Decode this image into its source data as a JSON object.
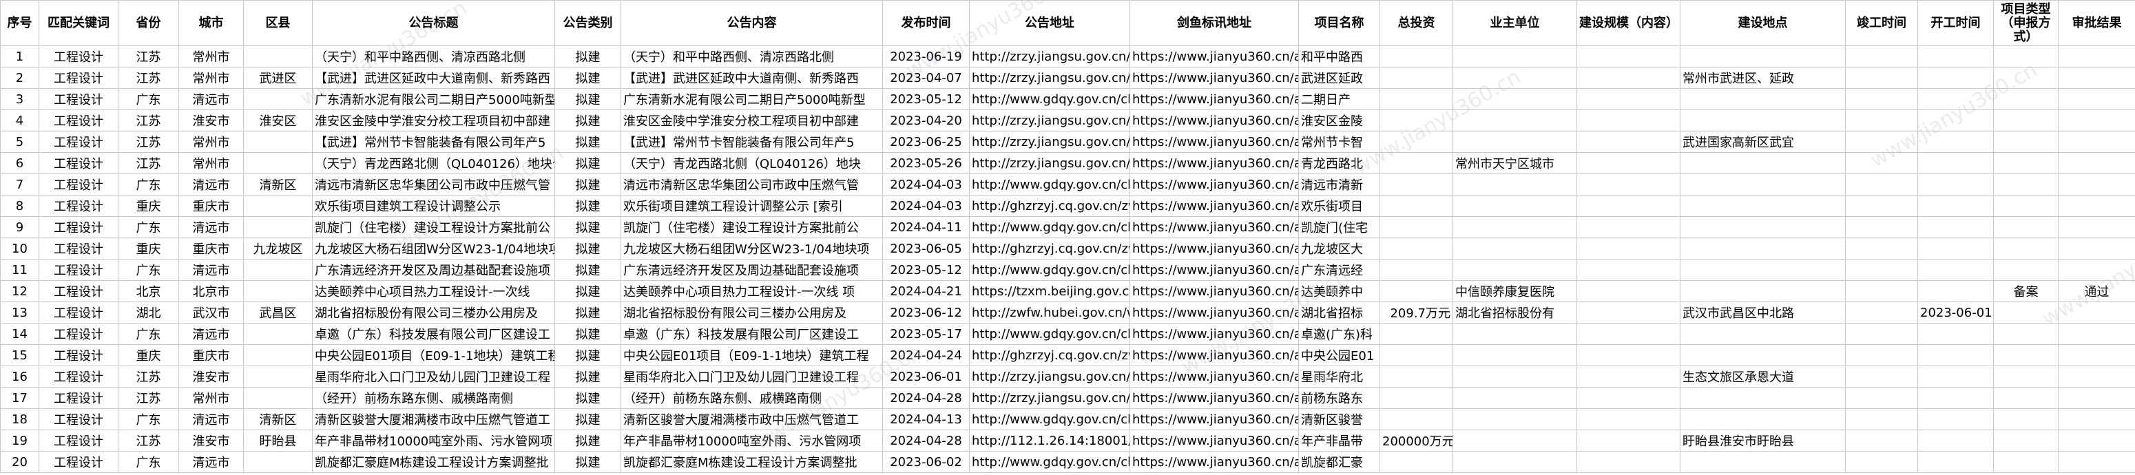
{
  "watermark": "www.jianyu360.cn",
  "columns": [
    "序号",
    "匹配关键词",
    "省份",
    "城市",
    "区县",
    "公告标题",
    "公告类别",
    "公告内容",
    "发布时间",
    "公告地址",
    "剑鱼标讯地址",
    "项目名称",
    "总投资",
    "业主单位",
    "建设规模（内容）",
    "建设地点",
    "竣工时间",
    "开工时间",
    "项目类型（申报方式）",
    "审批结果"
  ],
  "rows": [
    [
      "1",
      "工程设计",
      "江苏",
      "常州市",
      "",
      "（天宁）和平中路西侧、清凉西路北侧",
      "拟建",
      "（天宁）和平中路西侧、清凉西路北侧",
      "2023-06-19",
      "http://zrzy.jiangsu.gov.cn/gt",
      "https://www.jianyu360.cn/ar",
      "和平中路西",
      "",
      "",
      "",
      "",
      "",
      "",
      "",
      ""
    ],
    [
      "2",
      "工程设计",
      "江苏",
      "常州市",
      "武进区",
      "【武进】武进区延政中大道南侧、新秀路西",
      "拟建",
      "【武进】武进区延政中大道南侧、新秀路西",
      "2023-04-07",
      "http://zrzy.jiangsu.gov.cn/gt",
      "https://www.jianyu360.cn/ar",
      "武进区延政",
      "",
      "",
      "",
      "常州市武进区、延政",
      "",
      "",
      "",
      ""
    ],
    [
      "3",
      "工程设计",
      "广东",
      "清远市",
      "",
      "广东清新水泥有限公司二期日产5000吨新型",
      "拟建",
      "广东清新水泥有限公司二期日产5000吨新型",
      "2023-05-12",
      "http://www.gdqy.gov.cn/ch",
      "https://www.jianyu360.cn/ar",
      "二期日产",
      "",
      "",
      "",
      "",
      "",
      "",
      "",
      ""
    ],
    [
      "4",
      "工程设计",
      "江苏",
      "淮安市",
      "淮安区",
      "淮安区金陵中学淮安分校工程项目初中部建",
      "拟建",
      "淮安区金陵中学淮安分校工程项目初中部建",
      "2023-04-20",
      "http://zrzy.jiangsu.gov.cn/gt",
      "https://www.jianyu360.cn/ar",
      "淮安区金陵",
      "",
      "",
      "",
      "",
      "",
      "",
      "",
      ""
    ],
    [
      "5",
      "工程设计",
      "江苏",
      "常州市",
      "",
      "【武进】常州节卡智能装备有限公司年产5",
      "拟建",
      "【武进】常州节卡智能装备有限公司年产5",
      "2023-06-25",
      "http://zrzy.jiangsu.gov.cn/gt",
      "https://www.jianyu360.cn/ar",
      "常州节卡智",
      "",
      "",
      "",
      "武进国家高新区武宜",
      "",
      "",
      "",
      ""
    ],
    [
      "6",
      "工程设计",
      "江苏",
      "常州市",
      "",
      "（天宁）青龙西路北侧（QL040126）地块公",
      "拟建",
      "（天宁）青龙西路北侧（QL040126）地块",
      "2023-05-26",
      "http://zrzy.jiangsu.gov.cn/gt",
      "https://www.jianyu360.cn/ar",
      "青龙西路北",
      "",
      "常州市天宁区城市",
      "",
      "",
      "",
      "",
      "",
      ""
    ],
    [
      "7",
      "工程设计",
      "广东",
      "清远市",
      "清新区",
      "清远市清新区忠华集团公司市政中压燃气管",
      "拟建",
      "清远市清新区忠华集团公司市政中压燃气管",
      "2024-04-03",
      "http://www.gdqy.gov.cn/ch",
      "https://www.jianyu360.cn/ar",
      "清远市清新",
      "",
      "",
      "",
      "",
      "",
      "",
      "",
      ""
    ],
    [
      "8",
      "工程设计",
      "重庆",
      "重庆市",
      "",
      "欢乐街项目建筑工程设计调整公示",
      "拟建",
      "欢乐街项目建筑工程设计调整公示 [索引",
      "2024-04-03",
      "http://ghzrzyj.cq.gov.cn/zw",
      "https://www.jianyu360.cn/ar",
      "欢乐街项目",
      "",
      "",
      "",
      "",
      "",
      "",
      "",
      ""
    ],
    [
      "9",
      "工程设计",
      "广东",
      "清远市",
      "",
      "凯旋门（住宅楼）建设工程设计方案批前公",
      "拟建",
      "凯旋门（住宅楼）建设工程设计方案批前公",
      "2024-04-11",
      "http://www.gdqy.gov.cn/ch",
      "https://www.jianyu360.cn/ar",
      "凯旋门(住宅",
      "",
      "",
      "",
      "",
      "",
      "",
      "",
      ""
    ],
    [
      "10",
      "工程设计",
      "重庆",
      "重庆市",
      "九龙坡区",
      "九龙坡区大杨石组团W分区W23-1/04地块项",
      "拟建",
      "九龙坡区大杨石组团W分区W23-1/04地块项",
      "2023-06-05",
      "http://ghzrzyj.cq.gov.cn/zw",
      "https://www.jianyu360.cn/ar",
      "九龙坡区大",
      "",
      "",
      "",
      "",
      "",
      "",
      "",
      ""
    ],
    [
      "11",
      "工程设计",
      "广东",
      "清远市",
      "",
      "广东清远经济开发区及周边基础配套设施项",
      "拟建",
      "广东清远经济开发区及周边基础配套设施项",
      "2023-05-12",
      "http://www.gdqy.gov.cn/ch",
      "https://www.jianyu360.cn/ar",
      "广东清远经",
      "",
      "",
      "",
      "",
      "",
      "",
      "",
      ""
    ],
    [
      "12",
      "工程设计",
      "北京",
      "北京市",
      "",
      "达美颐养中心项目热力工程设计-一次线",
      "拟建",
      "达美颐养中心项目热力工程设计-一次线 项",
      "2024-04-21",
      "https://tzxm.beijing.gov.cn/i",
      "https://www.jianyu360.cn/ar",
      "达美颐养中",
      "",
      "中信颐养康复医院",
      "",
      "",
      "",
      "",
      "备案",
      "通过"
    ],
    [
      "13",
      "工程设计",
      "湖北",
      "武汉市",
      "武昌区",
      "湖北省招标股份有限公司三楼办公用房及",
      "拟建",
      "湖北省招标股份有限公司三楼办公用房及",
      "2023-06-12",
      "http://zwfw.hubei.gov.cn/w",
      "https://www.jianyu360.cn/ar",
      "湖北省招标",
      "209.7万元",
      "湖北省招标股份有",
      "",
      "武汉市武昌区中北路",
      "",
      "2023-06-01",
      "",
      ""
    ],
    [
      "14",
      "工程设计",
      "广东",
      "清远市",
      "",
      "卓邀（广东）科技发展有限公司厂区建设工",
      "拟建",
      "卓邀（广东）科技发展有限公司厂区建设工",
      "2023-05-17",
      "http://www.gdqy.gov.cn/ch",
      "https://www.jianyu360.cn/ar",
      "卓邀(广东)科",
      "",
      "",
      "",
      "",
      "",
      "",
      "",
      ""
    ],
    [
      "15",
      "工程设计",
      "重庆",
      "重庆市",
      "",
      "中央公园E01项目（E09-1-1地块）建筑工程",
      "拟建",
      "中央公园E01项目（E09-1-1地块）建筑工程",
      "2024-04-24",
      "http://ghzrzyj.cq.gov.cn/zw",
      "https://www.jianyu360.cn/ar",
      "中央公园E01",
      "",
      "",
      "",
      "",
      "",
      "",
      "",
      ""
    ],
    [
      "16",
      "工程设计",
      "江苏",
      "淮安市",
      "",
      "星雨华府北入口门卫及幼儿园门卫建设工程",
      "拟建",
      "星雨华府北入口门卫及幼儿园门卫建设工程",
      "2023-06-01",
      "http://zrzy.jiangsu.gov.cn/gt",
      "https://www.jianyu360.cn/ar",
      "星雨华府北",
      "",
      "",
      "",
      "生态文旅区承恩大道",
      "",
      "",
      "",
      ""
    ],
    [
      "17",
      "工程设计",
      "江苏",
      "常州市",
      "",
      "（经开）前杨东路东侧、戚横路南侧",
      "拟建",
      "（经开）前杨东路东侧、戚横路南侧",
      "2024-04-28",
      "http://zrzy.jiangsu.gov.cn/gt",
      "https://www.jianyu360.cn/ar",
      "前杨东路东",
      "",
      "",
      "",
      "",
      "",
      "",
      "",
      ""
    ],
    [
      "18",
      "工程设计",
      "广东",
      "清远市",
      "清新区",
      "清新区骏誉大厦湘满楼市政中压燃气管道工",
      "拟建",
      "清新区骏誉大厦湘满楼市政中压燃气管道工",
      "2024-04-13",
      "http://www.gdqy.gov.cn/ch",
      "https://www.jianyu360.cn/ar",
      "清新区骏誉",
      "",
      "",
      "",
      "",
      "",
      "",
      "",
      ""
    ],
    [
      "19",
      "工程设计",
      "江苏",
      "淮安市",
      "盱眙县",
      "年产非晶带材10000吨室外雨、污水管网项",
      "拟建",
      "年产非晶带材10000吨室外雨、污水管网项",
      "2024-04-28",
      "http://112.1.26.14:18001/wi",
      "https://www.jianyu360.cn/ar",
      "年产非晶带",
      "200000万元",
      "",
      "",
      "盱眙县淮安市盱眙县",
      "",
      "",
      "",
      ""
    ],
    [
      "20",
      "工程设计",
      "广东",
      "清远市",
      "",
      "凯旋都汇豪庭M栋建设工程设计方案调整批",
      "拟建",
      "凯旋都汇豪庭M栋建设工程设计方案调整批",
      "2023-06-02",
      "http://www.gdqy.gov.cn/ch",
      "https://www.jianyu360.cn/ar",
      "凯旋都汇豪",
      "",
      "",
      "",
      "",
      "",
      "",
      "",
      ""
    ]
  ]
}
